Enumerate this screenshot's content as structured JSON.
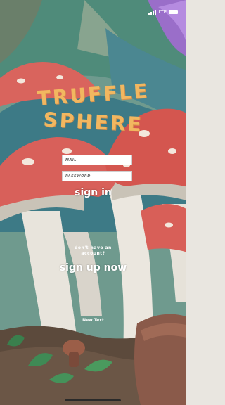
{
  "status_bar": {
    "network": "LTE"
  },
  "logo": {
    "line1": "TRUFFLE",
    "line2": "SPHERE"
  },
  "form": {
    "mail_placeholder": "MAIL",
    "password_placeholder": "PASSWORD"
  },
  "actions": {
    "signin_label": "sign in",
    "signup_prompt_line1": "don't have an",
    "signup_prompt_line2": "account?",
    "signup_label": "sign up now",
    "new_text_label": "New Text"
  },
  "colors": {
    "logo": "#f2b760",
    "mushroom_cap": "#d8605a",
    "stem": "#e8e4dc",
    "background_teal": "#3d7a86"
  }
}
